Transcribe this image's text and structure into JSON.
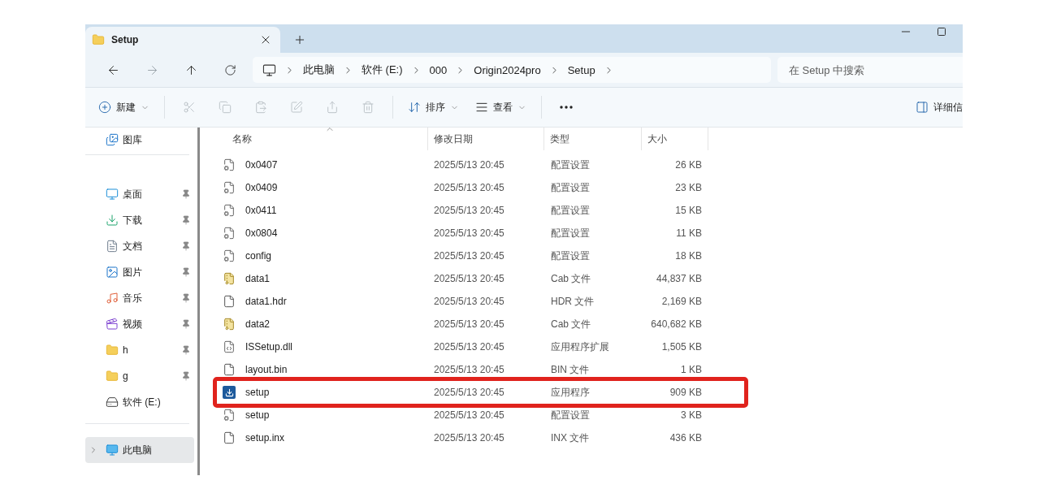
{
  "tabs": [
    {
      "title": "Setup",
      "selected": true
    }
  ],
  "address": {
    "crumbs": [
      "此电脑",
      "软件 (E:)",
      "000",
      "Origin2024pro",
      "Setup"
    ]
  },
  "search": {
    "placeholder": "在 Setup 中搜索"
  },
  "toolbar": {
    "new_label": "新建",
    "edit_actions": [
      {
        "disabled": true
      },
      {
        "disabled": true
      },
      {
        "disabled": true
      },
      {
        "disabled": true
      },
      {
        "disabled": true
      },
      {
        "disabled": true
      }
    ],
    "sort_label": "排序",
    "view_label": "查看",
    "details_label": "详细信"
  },
  "sidebar": {
    "sections": [
      [
        {
          "label": "图库",
          "kind": "gallery",
          "pinned": false,
          "selected": false
        }
      ],
      [
        {
          "label": "桌面",
          "kind": "desktop",
          "pinned": true,
          "selected": false
        },
        {
          "label": "下载",
          "kind": "download",
          "pinned": true,
          "selected": false
        },
        {
          "label": "文档",
          "kind": "documents",
          "pinned": true,
          "selected": false
        },
        {
          "label": "图片",
          "kind": "pictures",
          "pinned": true,
          "selected": false
        },
        {
          "label": "音乐",
          "kind": "music",
          "pinned": true,
          "selected": false
        },
        {
          "label": "视频",
          "kind": "videos",
          "pinned": true,
          "selected": false
        },
        {
          "label": "h",
          "kind": "folder",
          "pinned": true,
          "selected": false
        },
        {
          "label": "g",
          "kind": "folder",
          "pinned": true,
          "selected": false
        },
        {
          "label": "软件 (E:)",
          "kind": "drive",
          "pinned": false,
          "selected": false
        }
      ],
      [
        {
          "label": "此电脑",
          "kind": "computer",
          "pinned": false,
          "selected": true
        }
      ]
    ]
  },
  "columns": [
    {
      "label": "名称",
      "sorted": true
    },
    {
      "label": "修改日期",
      "sorted": false
    },
    {
      "label": "类型",
      "sorted": false
    },
    {
      "label": "大小",
      "sorted": false
    }
  ],
  "rows": [
    {
      "name": "0x0407",
      "date": "2025/5/13 20:45",
      "type": "配置设置",
      "size": "26 KB",
      "kind": "config",
      "highlighted": false
    },
    {
      "name": "0x0409",
      "date": "2025/5/13 20:45",
      "type": "配置设置",
      "size": "23 KB",
      "kind": "config",
      "highlighted": false
    },
    {
      "name": "0x0411",
      "date": "2025/5/13 20:45",
      "type": "配置设置",
      "size": "15 KB",
      "kind": "config",
      "highlighted": false
    },
    {
      "name": "0x0804",
      "date": "2025/5/13 20:45",
      "type": "配置设置",
      "size": "11 KB",
      "kind": "config",
      "highlighted": false
    },
    {
      "name": "config",
      "date": "2025/5/13 20:45",
      "type": "配置设置",
      "size": "18 KB",
      "kind": "config",
      "highlighted": false
    },
    {
      "name": "data1",
      "date": "2025/5/13 20:45",
      "type": "Cab 文件",
      "size": "44,837 KB",
      "kind": "cab",
      "highlighted": false
    },
    {
      "name": "data1.hdr",
      "date": "2025/5/13 20:45",
      "type": "HDR 文件",
      "size": "2,169 KB",
      "kind": "file",
      "highlighted": false
    },
    {
      "name": "data2",
      "date": "2025/5/13 20:45",
      "type": "Cab 文件",
      "size": "640,682 KB",
      "kind": "cab",
      "highlighted": false
    },
    {
      "name": "ISSetup.dll",
      "date": "2025/5/13 20:45",
      "type": "应用程序扩展",
      "size": "1,505 KB",
      "kind": "dll",
      "highlighted": false
    },
    {
      "name": "layout.bin",
      "date": "2025/5/13 20:45",
      "type": "BIN 文件",
      "size": "1 KB",
      "kind": "file",
      "highlighted": false
    },
    {
      "name": "setup",
      "date": "2025/5/13 20:45",
      "type": "应用程序",
      "size": "909 KB",
      "kind": "exe",
      "highlighted": true
    },
    {
      "name": "setup",
      "date": "2025/5/13 20:45",
      "type": "配置设置",
      "size": "3 KB",
      "kind": "config",
      "highlighted": false
    },
    {
      "name": "setup.inx",
      "date": "2025/5/13 20:45",
      "type": "INX 文件",
      "size": "436 KB",
      "kind": "file",
      "highlighted": false
    }
  ]
}
